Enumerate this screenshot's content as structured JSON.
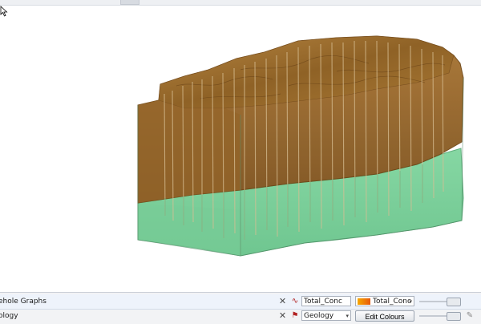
{
  "viewer": {
    "colors": {
      "upper_unit": "#8a5a1f",
      "upper_unit_top": "#9a6a2a",
      "lower_unit": "#7ccf9a",
      "drillhole": "#c9a97a"
    }
  },
  "panel": {
    "rows": [
      {
        "label": "ehole Graphs",
        "column_value": "Total_Conc",
        "colour_value": "Total_Conc",
        "close_icon": "x-icon",
        "type_icon": "graph-icon"
      },
      {
        "label": "ology",
        "column_value": "Geology",
        "button_label": "Edit Colours",
        "close_icon": "x-icon",
        "type_icon": "category-icon"
      }
    ]
  }
}
